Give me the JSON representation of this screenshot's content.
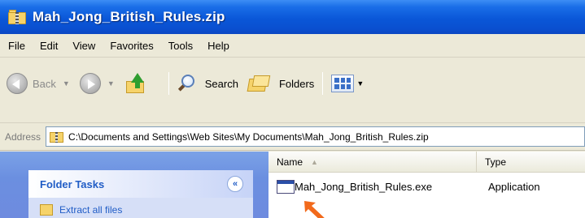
{
  "window": {
    "title": "Mah_Jong_British_Rules.zip"
  },
  "menubar": {
    "items": [
      "File",
      "Edit",
      "View",
      "Favorites",
      "Tools",
      "Help"
    ]
  },
  "toolbar": {
    "back_label": "Back",
    "search_label": "Search",
    "folders_label": "Folders"
  },
  "addressbar": {
    "label": "Address",
    "path": "C:\\Documents and Settings\\Web Sites\\My Documents\\Mah_Jong_British_Rules.zip"
  },
  "folder_tasks": {
    "header": "Folder Tasks",
    "collapse_glyph": "«",
    "first_task": "Extract all files"
  },
  "file_list": {
    "columns": {
      "name": "Name",
      "type": "Type"
    },
    "rows": [
      {
        "name": "Mah_Jong_British_Rules.exe",
        "type": "Application"
      }
    ]
  },
  "colors": {
    "title_bar": "#0a57d8",
    "task_pane": "#6e8bdf",
    "link": "#215dc6",
    "pointer_arrow": "#f26a1c"
  }
}
